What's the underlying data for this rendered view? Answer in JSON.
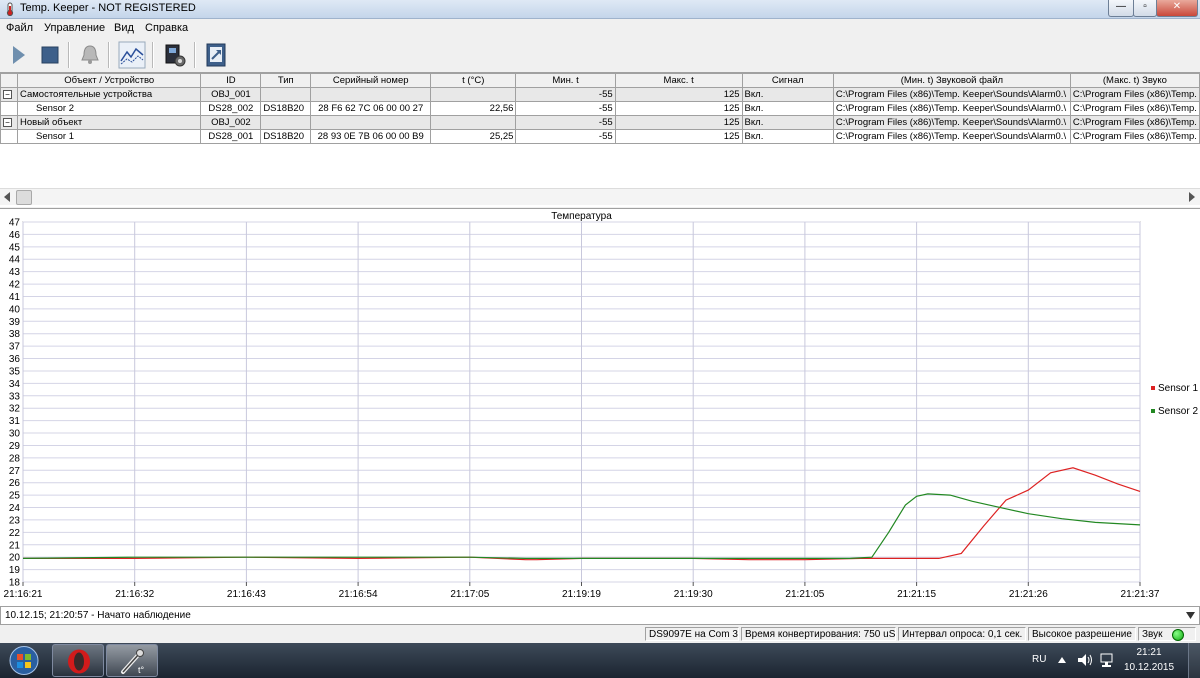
{
  "window": {
    "title": "Temp. Keeper  - NOT REGISTERED",
    "controls": {
      "minimize": "—",
      "maximize": "▫",
      "close": "✕"
    }
  },
  "menu": [
    "Файл",
    "Управление",
    "Вид",
    "Справка"
  ],
  "toolbar": {
    "buttons": [
      "play-icon",
      "stop-icon",
      "bell-icon",
      "chart-icon",
      "device-settings-icon",
      "export-icon"
    ]
  },
  "grid": {
    "columns": [
      "",
      "Объект / Устройство",
      "ID",
      "Тип",
      "Серийный номер",
      "t (°C)",
      "Мин. t",
      "Макс. t",
      "Сигнал",
      "(Мин. t) Звуковой файл",
      "(Макс. t) Звуко"
    ],
    "rows": [
      {
        "kind": "group",
        "expander": "−",
        "name": "Самостоятельные устройства",
        "id": "OBJ_001",
        "type": "",
        "serial": "",
        "temp": "",
        "min": "-55",
        "max": "125",
        "signal": "Вкл.",
        "min_file": "C:\\Program Files (x86)\\Temp. Keeper\\Sounds\\Alarm0.\\",
        "max_file": "C:\\Program Files (x86)\\Temp."
      },
      {
        "kind": "device",
        "expander": "",
        "name": "Sensor 2",
        "id": "DS28_002",
        "type": "DS18B20",
        "serial": "28 F6 62 7C 06 00 00 27",
        "temp": "22,56",
        "min": "-55",
        "max": "125",
        "signal": "Вкл.",
        "min_file": "C:\\Program Files (x86)\\Temp. Keeper\\Sounds\\Alarm0.\\",
        "max_file": "C:\\Program Files (x86)\\Temp."
      },
      {
        "kind": "group",
        "expander": "−",
        "name": "Новый объект",
        "id": "OBJ_002",
        "type": "",
        "serial": "",
        "temp": "",
        "min": "-55",
        "max": "125",
        "signal": "Вкл.",
        "min_file": "C:\\Program Files (x86)\\Temp. Keeper\\Sounds\\Alarm0.\\",
        "max_file": "C:\\Program Files (x86)\\Temp."
      },
      {
        "kind": "device",
        "expander": "",
        "name": "Sensor 1",
        "id": "DS28_001",
        "type": "DS18B20",
        "serial": "28 93 0E 7B 06 00 00 B9",
        "temp": "25,25",
        "min": "-55",
        "max": "125",
        "signal": "Вкл.",
        "min_file": "C:\\Program Files (x86)\\Temp. Keeper\\Sounds\\Alarm0.\\",
        "max_file": "C:\\Program Files (x86)\\Temp."
      }
    ]
  },
  "chart_data": {
    "type": "line",
    "title": "Температура",
    "xlabel": "",
    "ylabel": "",
    "ylim": [
      18,
      47
    ],
    "y_ticks": [
      18,
      19,
      20,
      21,
      22,
      23,
      24,
      25,
      26,
      27,
      28,
      29,
      30,
      31,
      32,
      33,
      34,
      35,
      36,
      37,
      38,
      39,
      40,
      41,
      42,
      43,
      44,
      45,
      46,
      47
    ],
    "x_ticks": [
      "21:16:21",
      "21:16:32",
      "21:16:43",
      "21:16:54",
      "21:17:05",
      "21:19:19",
      "21:19:30",
      "21:21:05",
      "21:21:15",
      "21:21:26",
      "21:21:37"
    ],
    "grid": true,
    "legend_position": "right",
    "series": [
      {
        "name": "Sensor 1",
        "color": "#dd2222",
        "x": [
          0,
          1,
          2,
          3,
          4,
          4.5,
          4.6,
          5,
          6,
          6.5,
          6.7,
          7,
          7.5,
          7.8,
          8.0,
          8.2,
          8.4,
          8.6,
          8.8,
          9.0,
          9.2,
          9.4,
          9.6,
          9.8,
          10.0
        ],
        "values": [
          19.9,
          19.9,
          20.0,
          19.9,
          20.0,
          19.8,
          19.8,
          19.9,
          19.9,
          19.8,
          19.8,
          19.8,
          19.9,
          19.9,
          19.9,
          19.9,
          20.3,
          22.5,
          24.6,
          25.4,
          26.8,
          27.2,
          26.6,
          25.9,
          25.3
        ]
      },
      {
        "name": "Sensor 2",
        "color": "#228822",
        "x": [
          0,
          1,
          2,
          3,
          4,
          4.5,
          5,
          6,
          6.5,
          7,
          7.2,
          7.4,
          7.6,
          7.75,
          7.9,
          8.0,
          8.1,
          8.3,
          8.5,
          8.8,
          9.0,
          9.3,
          9.6,
          10.0
        ],
        "values": [
          19.9,
          20.0,
          20.0,
          20.0,
          20.0,
          19.9,
          19.9,
          19.9,
          19.9,
          19.9,
          19.9,
          19.9,
          20.0,
          22.0,
          24.2,
          24.9,
          25.1,
          25.0,
          24.5,
          23.9,
          23.5,
          23.1,
          22.8,
          22.6
        ]
      }
    ]
  },
  "log": {
    "text": "10.12.15; 21:20:57 - Начато наблюдение"
  },
  "status": {
    "port": "DS9097E на Com 3",
    "conversion": "Время конвертирования: 750 uS.",
    "interval": "Интервал опроса: 0,1 сек.",
    "resolution": "Высокое разрешение",
    "sound": "Звук"
  },
  "taskbar": {
    "lang": "RU",
    "time": "21:21",
    "date": "10.12.2015"
  }
}
